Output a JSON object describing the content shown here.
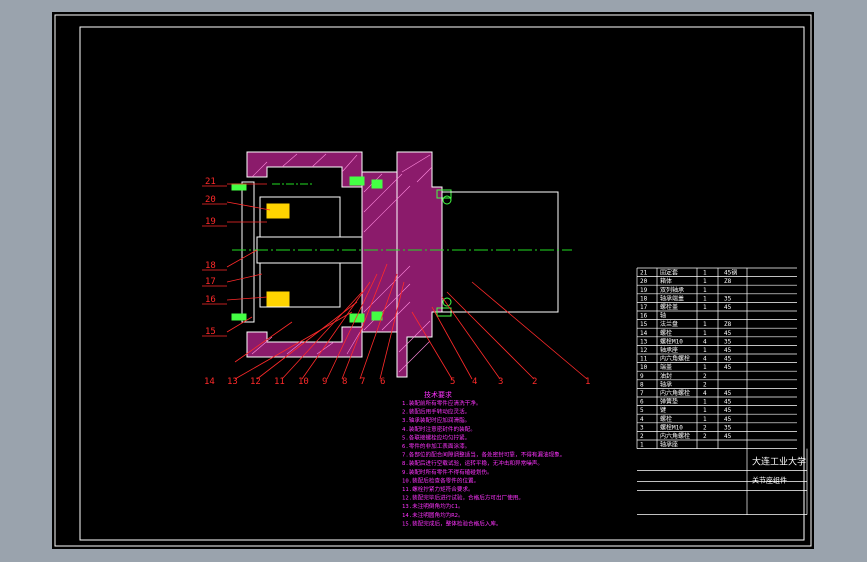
{
  "drawing": {
    "colors": {
      "background": "#000000",
      "frame": "#ffffff",
      "part_fill": "#8b1b6b",
      "leader_red": "#ff2a2a",
      "centerline": "#22dd22",
      "notes_magenta": "#ff33ff",
      "bolt_green": "#44ff44",
      "bearing_yellow": "#ffd400"
    },
    "balloons": {
      "left": [
        "21",
        "20",
        "19",
        "18",
        "17",
        "16",
        "15"
      ],
      "bottom": [
        "14",
        "13",
        "12",
        "11",
        "10",
        "9",
        "8",
        "7",
        "6",
        "5",
        "4",
        "3",
        "2",
        "1"
      ]
    },
    "notes": {
      "heading": "技术要求",
      "lines": [
        "1.装配前所有零件应清洗干净。",
        "2.装配后用手转动应灵活。",
        "3.轴承装配时应加润滑脂。",
        "4.装配时注意密封件的装配。",
        "5.各联接螺栓应均匀拧紧。",
        "6.零件的非加工表面涂漆。",
        "7.各部位的配合间隙调整适当，各处密封可靠，不得有漏油现象。",
        "8.装配后进行空载试验，运转平稳，无冲击和异常噪声。",
        "9.装配时所有零件不得有磕碰划伤。",
        "10.装配后检查各零件的位置。",
        "11.螺栓拧紧力矩符合要求。",
        "12.装配完毕后进行试验，合格后方可出厂使用。",
        "13.未注明倒角均为C1。",
        "14.未注明圆角均为R2。",
        "15.装配完成后，整体检验合格后入库。"
      ]
    },
    "bom": {
      "rows": [
        [
          "21",
          "固定套",
          "1",
          "45钢"
        ],
        [
          "20",
          "箱体",
          "1",
          "Z8"
        ],
        [
          "19",
          "双列轴承",
          "1",
          ""
        ],
        [
          "18",
          "轴承端盖",
          "1",
          "35"
        ],
        [
          "17",
          "螺栓盖",
          "1",
          "45"
        ],
        [
          "16",
          "轴",
          "",
          ""
        ],
        [
          "15",
          "法兰盘",
          "1",
          "Z8"
        ],
        [
          "14",
          "螺栓",
          "1",
          "45"
        ],
        [
          "13",
          "螺栓M10",
          "4",
          "35"
        ],
        [
          "12",
          "轴承座",
          "1",
          "45"
        ],
        [
          "11",
          "内六角螺栓",
          "4",
          "45"
        ],
        [
          "10",
          "端盖",
          "1",
          "45"
        ],
        [
          "9",
          "油封",
          "2",
          ""
        ],
        [
          "8",
          "轴承",
          "2",
          ""
        ],
        [
          "7",
          "内六角螺栓",
          "4",
          "45"
        ],
        [
          "6",
          "弹簧垫",
          "1",
          "45"
        ],
        [
          "5",
          "键",
          "1",
          "45"
        ],
        [
          "4",
          "螺栓",
          "1",
          "45"
        ],
        [
          "3",
          "螺栓M10",
          "2",
          "35"
        ],
        [
          "2",
          "内六角螺栓",
          "2",
          "45"
        ],
        [
          "1",
          "轴承座",
          "",
          ""
        ]
      ],
      "title_school": "大连工业大学",
      "title_name": "关节座组件"
    }
  }
}
